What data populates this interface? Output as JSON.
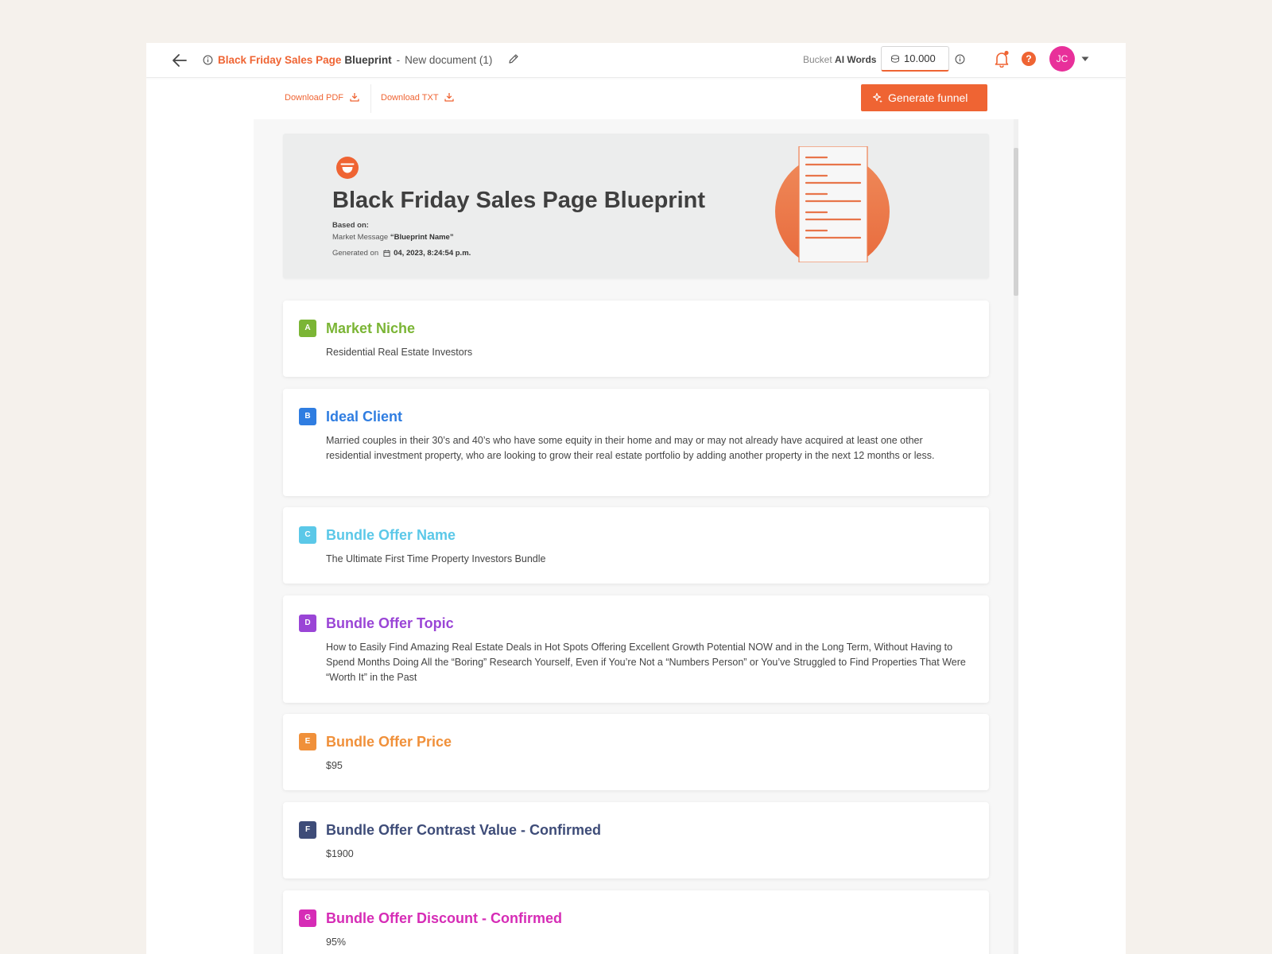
{
  "header": {
    "title_accent": "Black Friday Sales Page",
    "title_strong": "Blueprint",
    "separator": "-",
    "doc_name": "New document (1)",
    "bucket_prefix": "Bucket",
    "bucket_strong": "AI Words",
    "words_value": "10.000",
    "avatar_initials": "JC",
    "help_glyph": "?"
  },
  "toolbar": {
    "download_pdf": "Download PDF",
    "download_txt": "Download TXT",
    "generate": "Generate funnel"
  },
  "hero": {
    "title": "Black Friday Sales Page Blueprint",
    "based_on": "Based on:",
    "market_prefix": "Market Message",
    "market_name": "“Blueprint Name”",
    "generated_prefix": "Generated on",
    "generated_value": "04, 2023, 8:24:54 p.m."
  },
  "sections": [
    {
      "letter": "A",
      "title": "Market Niche",
      "color": "#7bb535",
      "body": "Residential Real Estate Investors"
    },
    {
      "letter": "B",
      "title": "Ideal Client",
      "color": "#2f7de1",
      "body": "Married couples in their 30’s and 40’s who have some equity in their home and may or may not already have acquired at least one other residential investment property, who are looking to grow their real estate portfolio by adding another property in the next 12 months or less."
    },
    {
      "letter": "C",
      "title": "Bundle Offer Name",
      "color": "#5bc8e8",
      "body": "The Ultimate First Time Property Investors Bundle"
    },
    {
      "letter": "D",
      "title": "Bundle Offer Topic",
      "color": "#9a45d6",
      "body": "How to Easily Find Amazing Real Estate Deals in Hot Spots Offering Excellent Growth Potential NOW and in the Long Term, Without Having to Spend Months Doing All the “Boring” Research Yourself, Even if You’re Not a “Numbers Person” or You’ve Struggled to Find Properties That Were “Worth It” in the Past"
    },
    {
      "letter": "E",
      "title": "Bundle Offer Price",
      "color": "#f0903a",
      "body": "$95"
    },
    {
      "letter": "F",
      "title": "Bundle Offer Contrast Value - Confirmed",
      "color": "#3e4c78",
      "body": "$1900"
    },
    {
      "letter": "G",
      "title": "Bundle Offer Discount - Confirmed",
      "color": "#d62cb6",
      "body": "95%"
    }
  ],
  "icons": {
    "back": "arrow-left-icon",
    "info": "info-icon",
    "edit": "pencil-icon",
    "coin": "coin-icon",
    "bell": "bell-icon",
    "help": "help-icon",
    "caret": "caret-down-icon",
    "download": "download-icon",
    "sparkle": "sparkle-icon",
    "calendar": "calendar-icon"
  },
  "colors": {
    "accent": "#ef6433",
    "avatar": "#e8309a",
    "page_background": "#f5f1ec"
  }
}
